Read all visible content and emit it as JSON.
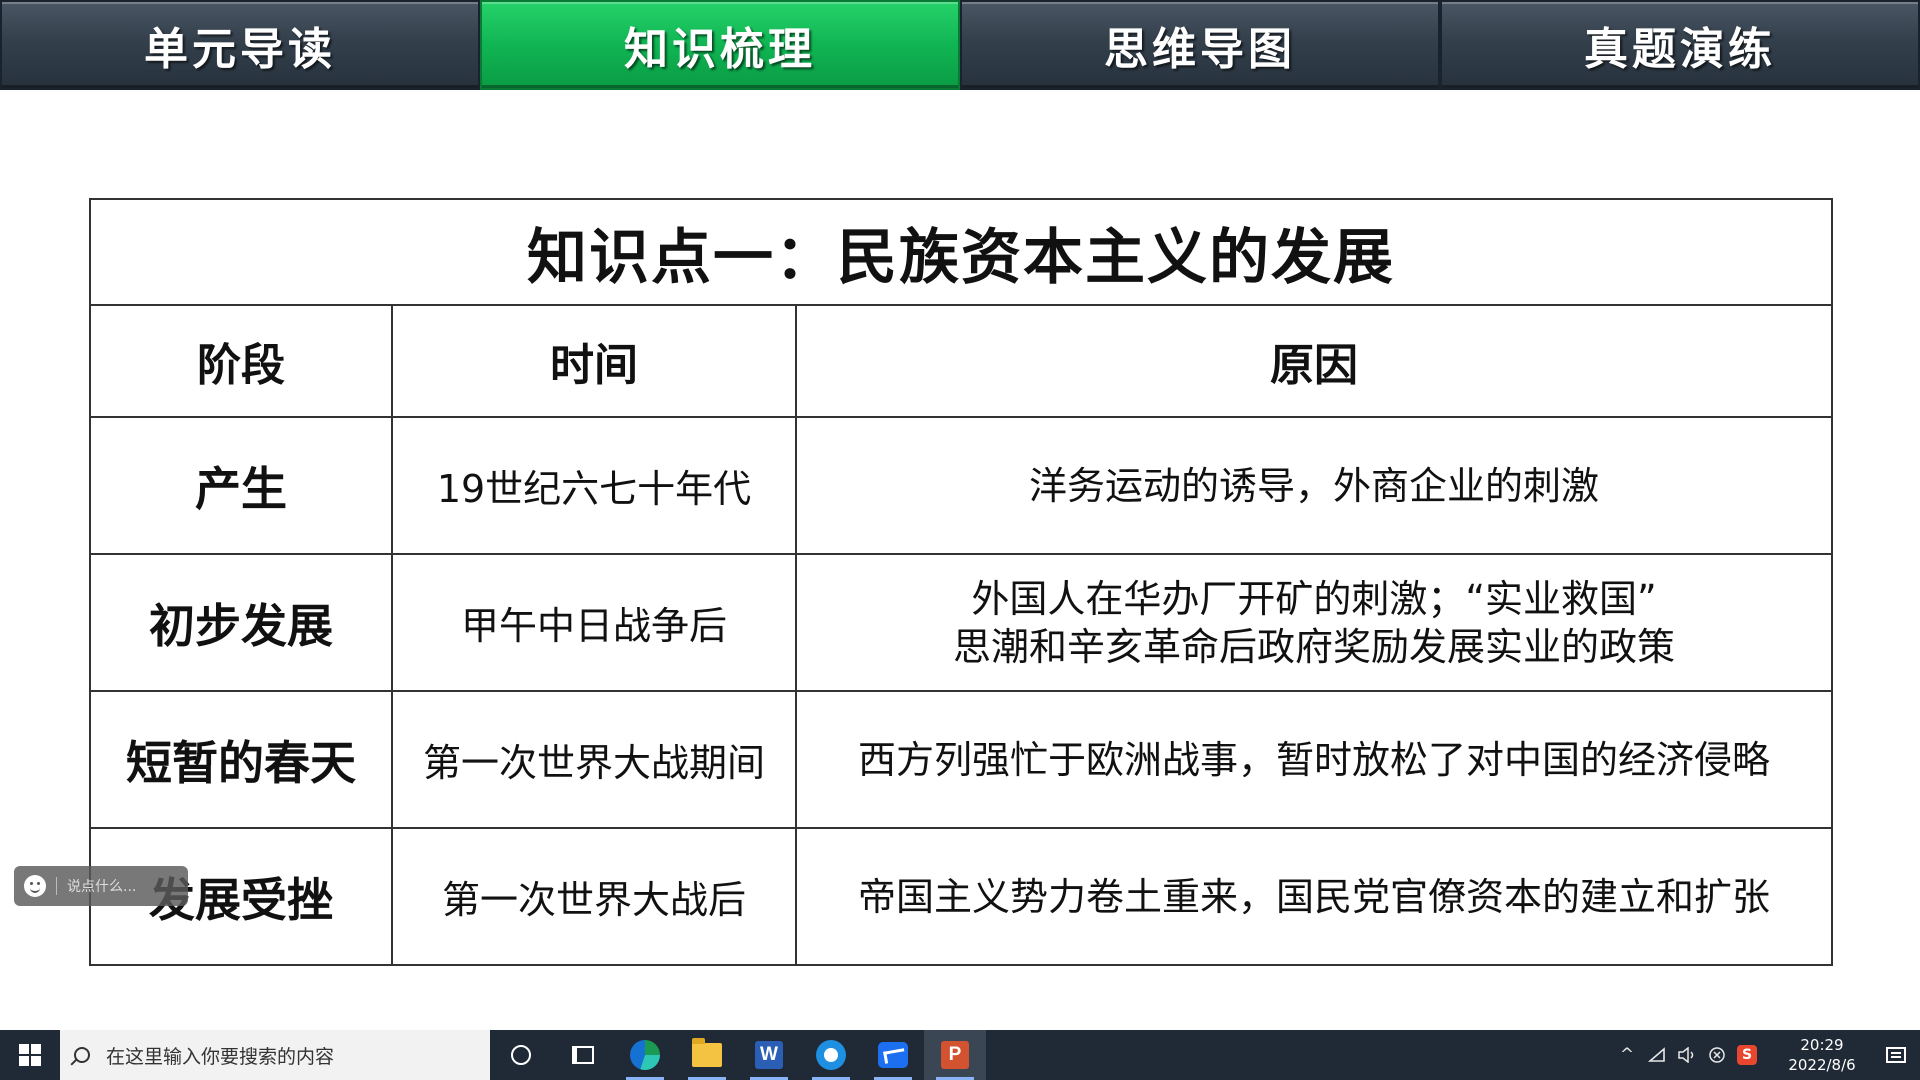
{
  "nav": {
    "tabs": [
      {
        "label": "单元导读"
      },
      {
        "label": "知识梳理"
      },
      {
        "label": "思维导图"
      },
      {
        "label": "真题演练"
      }
    ],
    "active_tab": "知识梳理"
  },
  "slide": {
    "title": "知识点一：民族资本主义的发展",
    "title_color": "#e41c1c",
    "headers": {
      "stage": "阶段",
      "time": "时间",
      "reason": "原因"
    },
    "rows": [
      {
        "stage": "产生",
        "time": "19世纪六七十年代",
        "reason_line1": "洋务运动的诱导，外商企业的刺激",
        "reason_line2": ""
      },
      {
        "stage": "初步发展",
        "time": "甲午中日战争后",
        "reason_line1": "外国人在华办厂开矿的刺激；“实业救国”",
        "reason_line2": "思潮和辛亥革命后政府奖励发展实业的政策"
      },
      {
        "stage": "短暂的春天",
        "time": "第一次世界大战期间",
        "reason_line1": "西方列强忙于欧洲战事，暂时放松了对中国的经济侵略",
        "reason_line2": ""
      },
      {
        "stage": "发展受挫",
        "time": "第一次世界大战后",
        "reason_line1": "帝国主义势力卷土重来，国民党官僚资本的建立和扩张",
        "reason_line2": ""
      }
    ]
  },
  "comment_widget": {
    "placeholder": "说点什么..."
  },
  "taskbar": {
    "search_placeholder": "在这里输入你要搜索的内容",
    "apps": [
      "cortana-icon",
      "task-view-icon",
      "edge-icon",
      "file-explorer-icon",
      "word-icon",
      "qq-browser-icon",
      "tencent-meeting-icon",
      "powerpoint-icon"
    ],
    "word_glyph": "W",
    "ppt_glyph": "P",
    "tray": {
      "chevron": "^",
      "ime_glyph": "S"
    },
    "clock": {
      "time": "20:29",
      "date": "2022/8/6"
    }
  },
  "colors": {
    "active_tab": "#10b553",
    "tab_bg": "#33404c",
    "taskbar_bg": "#1f2a36"
  }
}
